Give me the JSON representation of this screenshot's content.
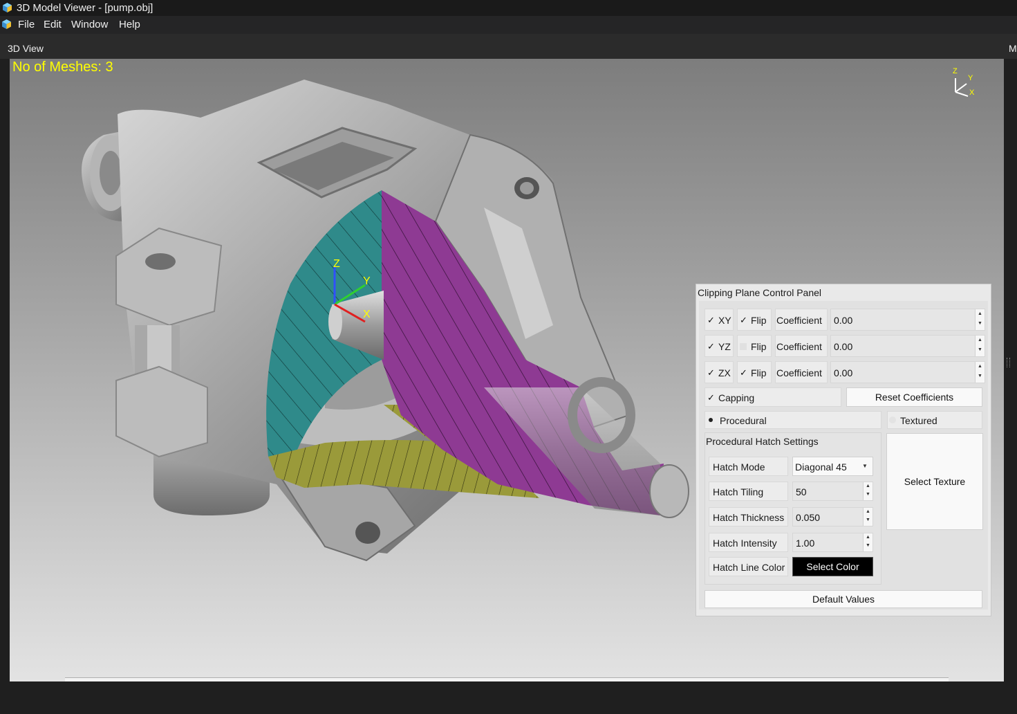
{
  "window": {
    "title": "3D Model Viewer - [pump.obj]"
  },
  "menu": {
    "items": [
      "File",
      "Edit",
      "Window",
      "Help"
    ]
  },
  "dock": {
    "title": "3D View",
    "right_tab": "M"
  },
  "viewport": {
    "mesh_count_text": "No of Meshes: 3",
    "gizmo": {
      "z": "Z",
      "y": "Y",
      "x": "X"
    },
    "model_axes": {
      "z": "Z",
      "y": "Y",
      "x": "X"
    }
  },
  "panel": {
    "title": "Clipping Plane Control Panel",
    "planes": [
      {
        "name": "XY",
        "enabled": true,
        "flip_label": "Flip",
        "flip": true,
        "coef_label": "Coefficient",
        "value": "0.00"
      },
      {
        "name": "YZ",
        "enabled": true,
        "flip_label": "Flip",
        "flip": false,
        "coef_label": "Coefficient",
        "value": "0.00"
      },
      {
        "name": "ZX",
        "enabled": true,
        "flip_label": "Flip",
        "flip": true,
        "coef_label": "Coefficient",
        "value": "0.00"
      }
    ],
    "check_mark": "✓",
    "capping": {
      "label": "Capping",
      "checked": true
    },
    "reset_button": "Reset Coefficients",
    "mode": {
      "procedural": "Procedural",
      "textured": "Textured",
      "selected": "procedural"
    },
    "hatch": {
      "title": "Procedural Hatch Settings",
      "mode_label": "Hatch Mode",
      "mode_value": "Diagonal 45",
      "tiling_label": "Hatch Tiling",
      "tiling_value": "50",
      "thickness_label": "Hatch Thickness",
      "thickness_value": "0.050",
      "intensity_label": "Hatch Intensity",
      "intensity_value": "1.00",
      "color_label": "Hatch Line Color",
      "color_button": "Select Color"
    },
    "select_texture": "Select Texture",
    "default_values": "Default Values"
  },
  "colors": {
    "mesh_text": "#ffff00",
    "cap_teal": "#2f8a8a",
    "cap_purple": "#8e3a93",
    "cap_olive": "#9a9a3a",
    "hatch_line": "#000000"
  }
}
